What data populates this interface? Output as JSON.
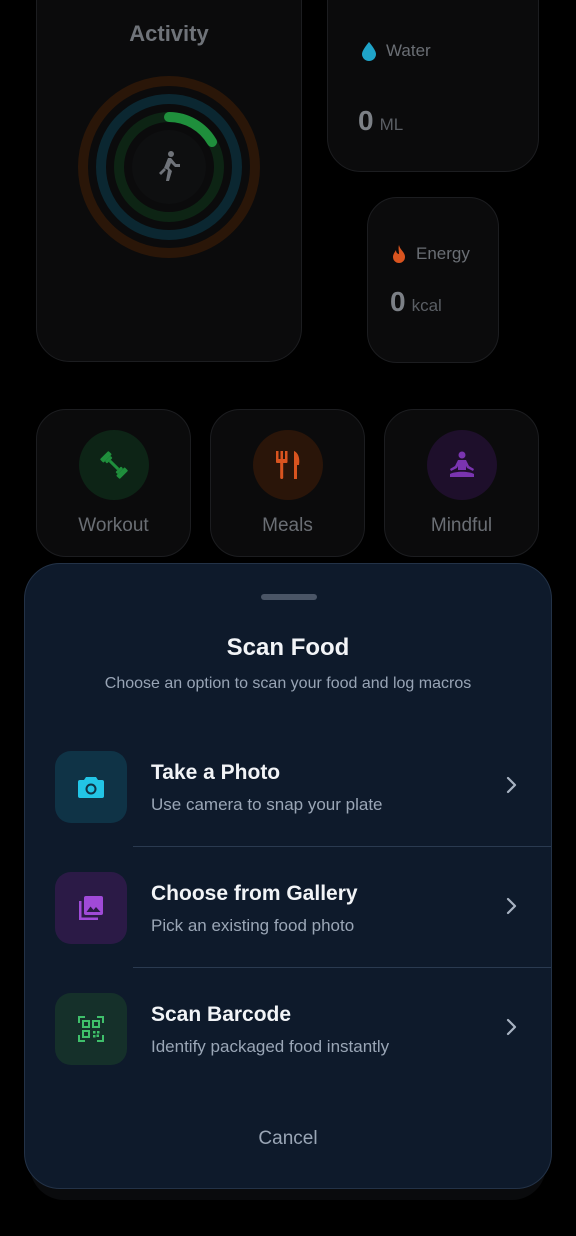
{
  "dashboard": {
    "activity": {
      "title": "Activity"
    },
    "water": {
      "label": "Water",
      "value": "0",
      "unit": "ML"
    },
    "energy": {
      "label": "Energy",
      "value": "0",
      "unit": "kcal"
    },
    "actions": [
      {
        "label": "Workout",
        "icon": "dumbbell-icon"
      },
      {
        "label": "Meals",
        "icon": "utensils-icon"
      },
      {
        "label": "Mindful",
        "icon": "meditation-icon"
      }
    ]
  },
  "sheet": {
    "title": "Scan Food",
    "subtitle": "Choose an option to scan your food and log macros",
    "options": [
      {
        "title": "Take a Photo",
        "subtitle": "Use camera to snap your plate",
        "icon": "camera-icon"
      },
      {
        "title": "Choose from Gallery",
        "subtitle": "Pick an existing food photo",
        "icon": "gallery-icon"
      },
      {
        "title": "Scan Barcode",
        "subtitle": "Identify packaged food instantly",
        "icon": "qr-code-icon"
      }
    ],
    "cancel_label": "Cancel"
  },
  "colors": {
    "sheet_bg": "#0e1a2b",
    "camera_accent": "#22c5e6",
    "gallery_accent": "#a04ad8",
    "barcode_accent": "#3fbf6b",
    "water_accent": "#1fa4c9",
    "energy_accent": "#d9541f",
    "activity_ring": "#1f8f3c"
  }
}
